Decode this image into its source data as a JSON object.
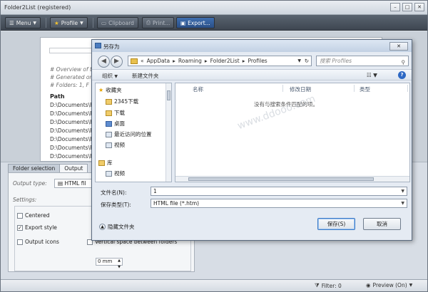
{
  "app": {
    "title": "Folder2List (registered)",
    "win_buttons": [
      "–",
      "□",
      "✕"
    ]
  },
  "toolbar": {
    "menu": "Menu",
    "profile": "Profile",
    "clipboard": "Clipboard",
    "print": "Print...",
    "export": "Export..."
  },
  "preview": {
    "comments": [
      "# Overview of th",
      "# Generated on",
      "# Folders: 1,  F"
    ],
    "path_header": "Path",
    "rows": [
      "D:\\Documents\\F",
      "D:\\Documents\\F",
      "D:\\Documents\\F",
      "D:\\Documents\\F",
      "D:\\Documents\\F",
      "D:\\Documents\\F",
      "D:\\Documents\\F",
      "D:\\Documents\\F"
    ]
  },
  "lower": {
    "tabs": [
      "Folder selection",
      "Output"
    ],
    "output_type_label": "Output type:",
    "output_type_value": "HTML fil",
    "settings_label": "Settings:",
    "centered": "Centered",
    "export_style": "Export style",
    "output_icons": "Output icons",
    "vspace": "Vertical space between folders",
    "spin_value": "0 mm"
  },
  "status": {
    "filter": "Filter: 0",
    "preview": "Preview (On)"
  },
  "dialog": {
    "title": "另存为",
    "close": "✕",
    "address": [
      "AppData",
      "Roaming",
      "Folder2List",
      "Profiles"
    ],
    "search_placeholder": "搜索 Profiles",
    "organize": "组织",
    "new_folder": "新建文件夹",
    "nav_items": [
      "收藏夹",
      "2345下载",
      "下载",
      "桌面",
      "最近访问的位置",
      "视频",
      "库",
      "视频"
    ],
    "columns": [
      "名称",
      "修改日期",
      "类型"
    ],
    "empty_text": "没有与搜索条件匹配的项。",
    "filename_label": "文件名(N):",
    "filename_value": "1",
    "filetype_label": "保存类型(T):",
    "filetype_value": "HTML file (*.htm)",
    "hide_folders": "隐藏文件夹",
    "save": "保存(S)",
    "cancel": "取消"
  },
  "watermark": "www.ddooo.com"
}
